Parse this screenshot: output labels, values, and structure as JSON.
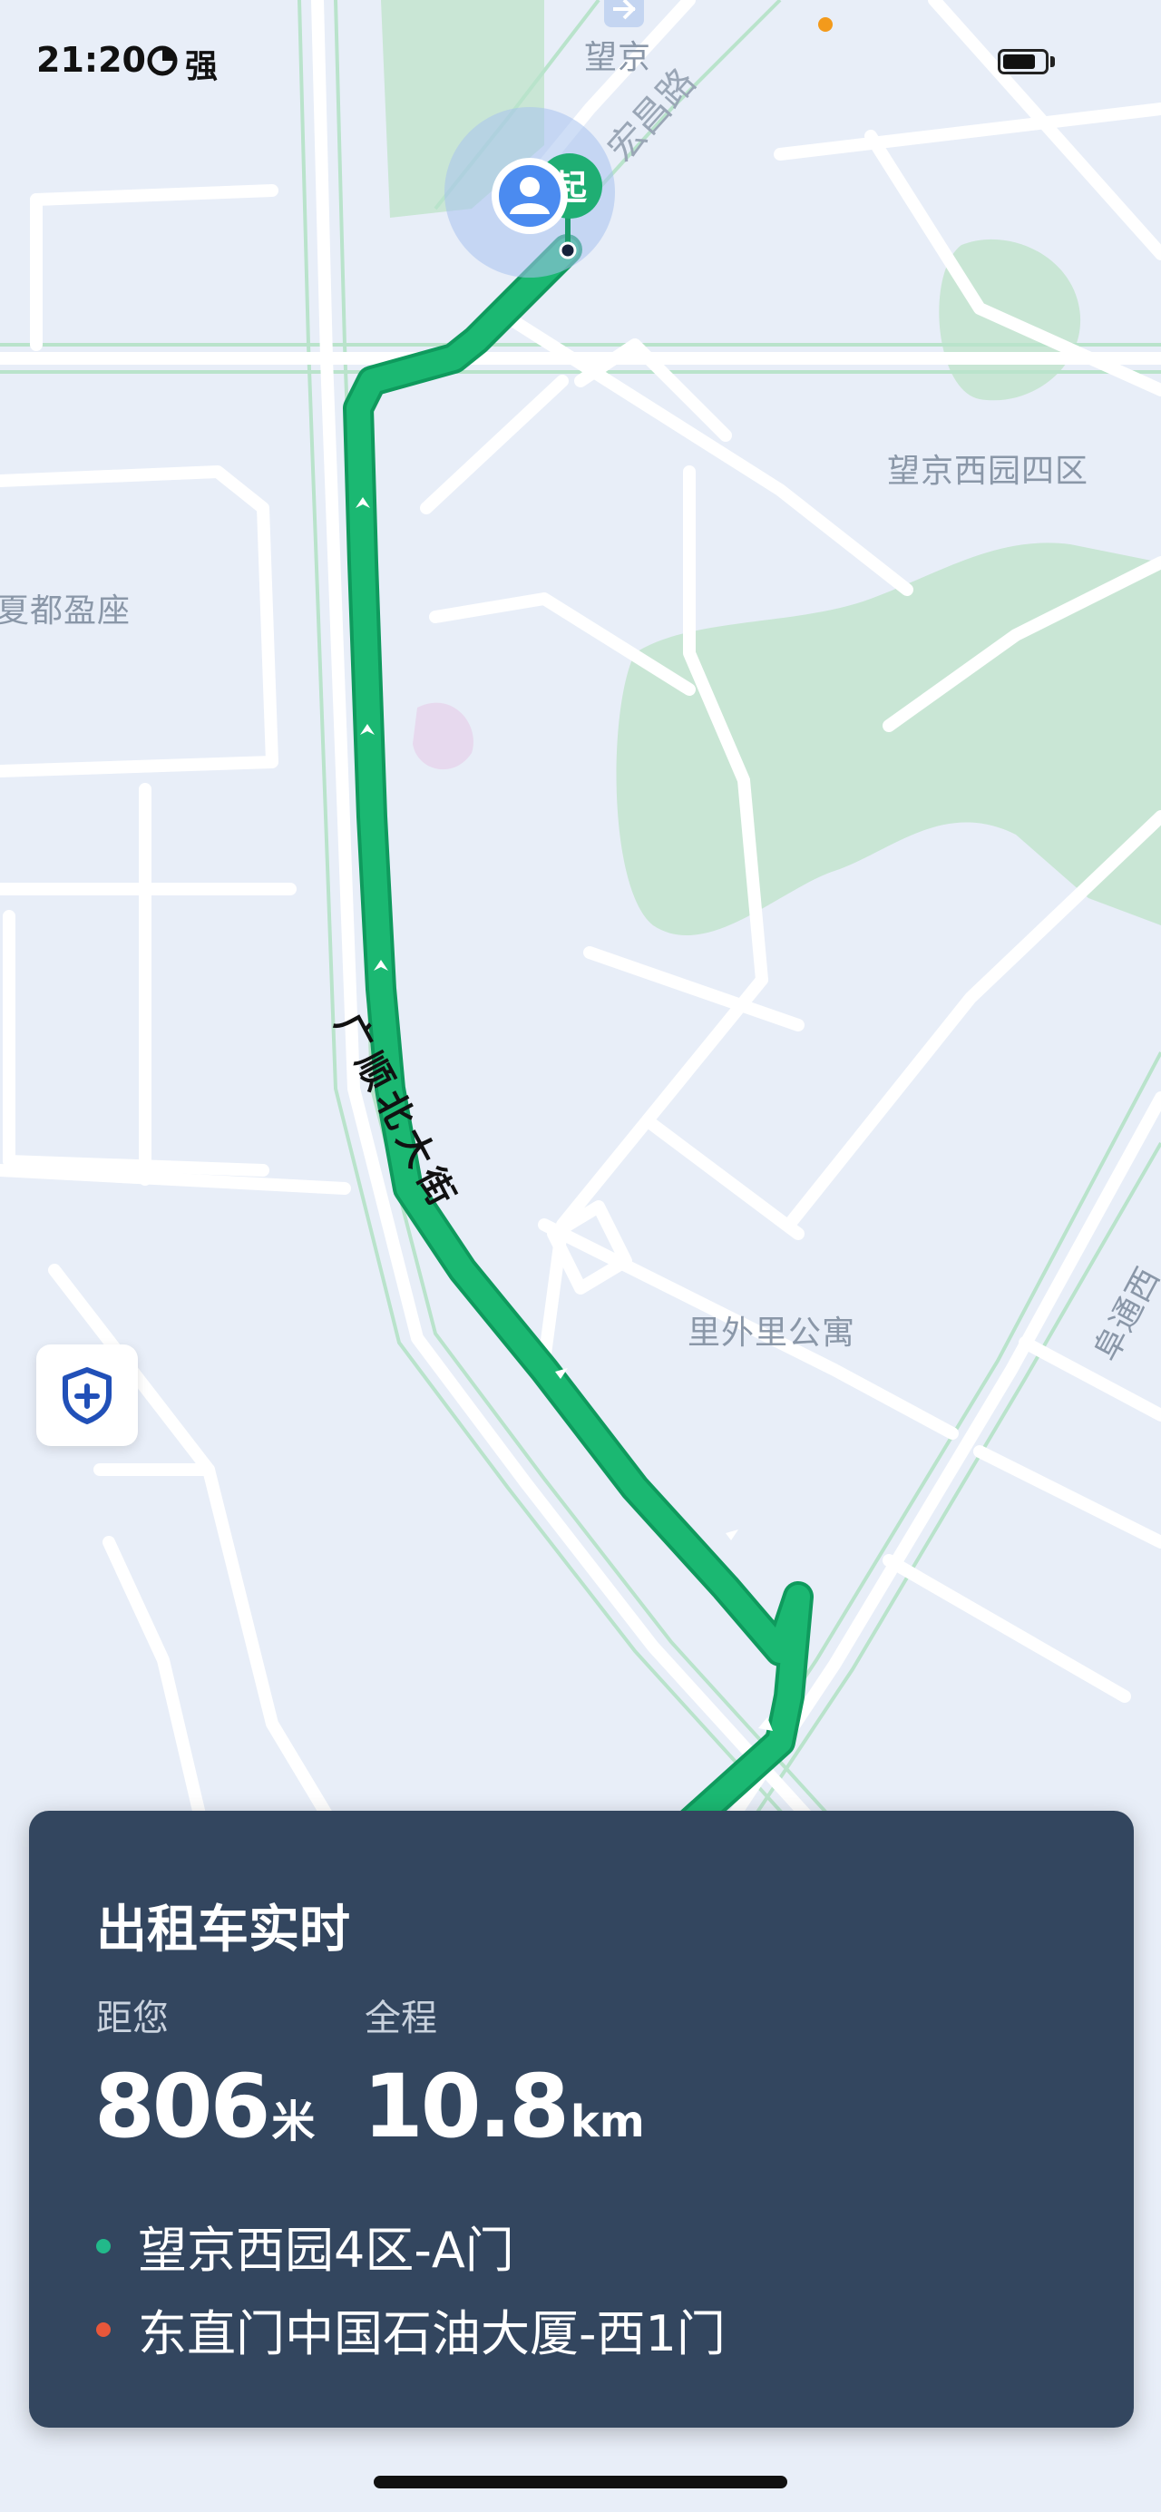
{
  "status_bar": {
    "time": "21:20",
    "signal_label": "强",
    "battery_level": 0.8
  },
  "map": {
    "labels": {
      "station": "望京",
      "road_hongchang": "宏昌路",
      "district_xiyuan": "望京西园四区",
      "building_xiadu": "夏都盈座",
      "road_guangshun": "广顺北大街",
      "apartment": "里外里公寓",
      "road_edge": "阜通西"
    },
    "start_marker": "起",
    "route_color": "#1bb872",
    "colors": {
      "land": "#e8eef8",
      "green_space": "#c9e6d5",
      "road": "#ffffff",
      "arterial": "#b9e3cb"
    }
  },
  "safety_button": {
    "icon": "shield-plus-icon"
  },
  "trip_card": {
    "title": "出租车实时",
    "distance_to_you": {
      "label": "距您",
      "value": "806",
      "unit": "米"
    },
    "total_distance": {
      "label": "全程",
      "value": "10.8",
      "unit": "km"
    },
    "pickup": {
      "name": "望京西园4区-A门",
      "dot_color": "#22b98a"
    },
    "dropoff": {
      "name": "东直门中国石油大厦-西1门",
      "dot_color": "#e8573a"
    },
    "background": "#33465f"
  }
}
